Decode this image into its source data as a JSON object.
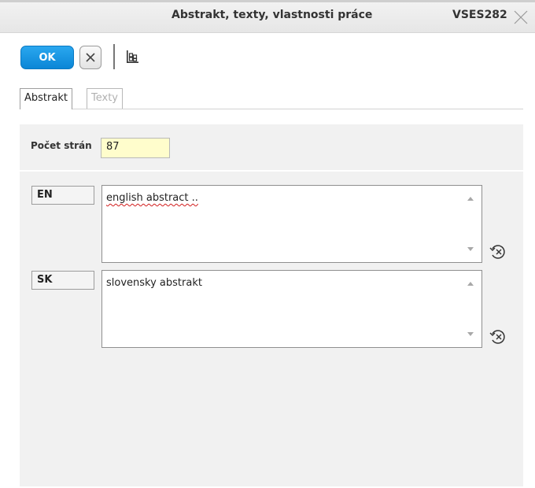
{
  "window": {
    "title": "Abstrakt, texty, vlastnosti práce",
    "code": "VSES282"
  },
  "toolbar": {
    "ok_label": "OK",
    "cancel_icon": "close-icon",
    "grid_icon": "grid-icon"
  },
  "tabs": [
    {
      "label": "Abstrakt",
      "active": true
    },
    {
      "label": "Texty",
      "active": false
    }
  ],
  "fields": {
    "page_count_label": "Počet strán",
    "page_count_value": "87"
  },
  "abstracts": [
    {
      "lang": "EN",
      "text": "english abstract ..",
      "reset_icon": "clear-history-icon"
    },
    {
      "lang": "SK",
      "text": "slovensky abstrakt",
      "reset_icon": "clear-history-icon"
    }
  ],
  "colors": {
    "ok_button": "#0b86d6",
    "highlight_input": "#fffdcc",
    "panel_bg": "#f1f1f1"
  }
}
